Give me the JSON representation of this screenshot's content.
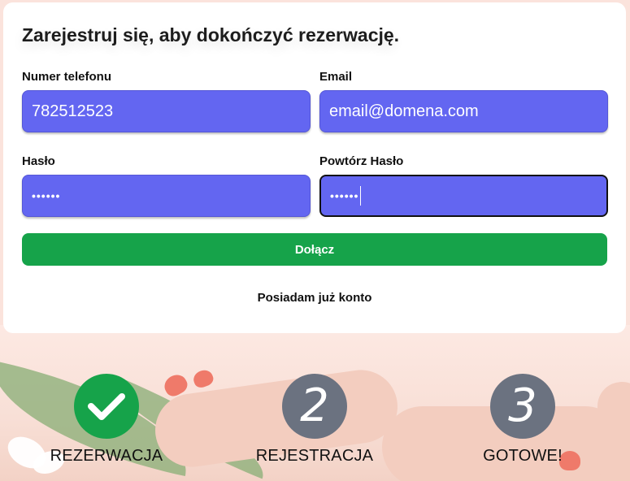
{
  "form": {
    "title": "Zarejestruj się, aby dokończyć rezerwację.",
    "phone": {
      "label": "Numer telefonu",
      "value": "782512523"
    },
    "email": {
      "label": "Email",
      "value": "email@domena.com"
    },
    "password": {
      "label": "Hasło",
      "value": "••••••"
    },
    "password_repeat": {
      "label": "Powtórz Hasło",
      "value": "••••••"
    },
    "join_label": "Dołącz",
    "login_link": "Posiadam już konto"
  },
  "steps": [
    {
      "label": "REZERWACJA",
      "number": "",
      "status": "done",
      "icon": "check-icon"
    },
    {
      "label": "REJESTRACJA",
      "number": "2",
      "status": "current"
    },
    {
      "label": "GOTOWE!",
      "number": "3",
      "status": "pending"
    }
  ],
  "colors": {
    "field_bg": "#6366f1",
    "button_bg": "#16a34a",
    "step_done": "#16a34a",
    "step_todo": "#6b7280",
    "page_bg": "#fbe3dc"
  }
}
